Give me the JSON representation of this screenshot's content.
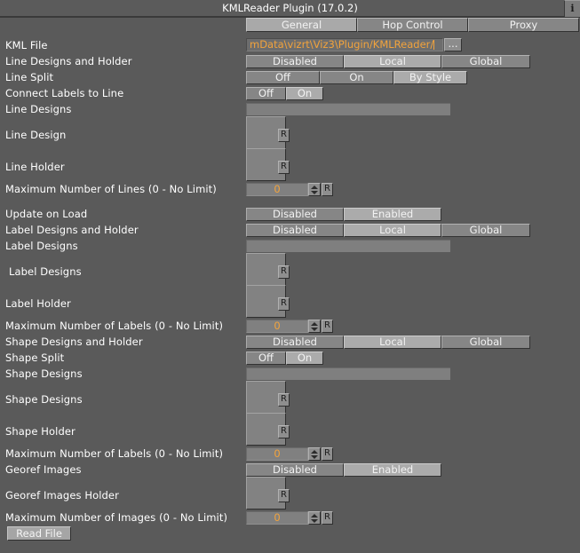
{
  "window": {
    "title": "KMLReader Plugin (17.0.2)",
    "info_button": "i"
  },
  "tabs": [
    {
      "label": "General",
      "selected": true
    },
    {
      "label": "Hop Control",
      "selected": false
    },
    {
      "label": "Proxy",
      "selected": false
    }
  ],
  "fields": {
    "kml_file": {
      "label": "KML File",
      "value": "mData\\vizrt\\Viz3\\Plugin/KMLReader/",
      "browse_label": "..."
    },
    "line_designs_and_holder": {
      "label": "Line Designs and Holder",
      "options": [
        "Disabled",
        "Local",
        "Global"
      ],
      "selected": "Local"
    },
    "line_split": {
      "label": "Line Split",
      "options": [
        "Off",
        "On",
        "By Style"
      ],
      "selected": "By Style"
    },
    "connect_labels_to_line": {
      "label": "Connect Labels to Line",
      "options": [
        "Off",
        "On"
      ],
      "selected": "On"
    },
    "line_designs_bar": {
      "label": "Line Designs"
    },
    "line_design": {
      "label": "Line Design",
      "reset_label": "R"
    },
    "line_holder": {
      "label": "Line Holder",
      "reset_label": "R"
    },
    "max_lines": {
      "label": "Maximum Number of Lines (0 - No Limit)",
      "value": "0",
      "reset_label": "R"
    },
    "update_on_load": {
      "label": "Update on Load",
      "options": [
        "Disabled",
        "Enabled"
      ],
      "selected": "Enabled"
    },
    "label_designs_and_holder": {
      "label": "Label Designs and Holder",
      "options": [
        "Disabled",
        "Local",
        "Global"
      ],
      "selected": "Local"
    },
    "label_designs_bar": {
      "label": "Label Designs"
    },
    "label_designs": {
      "label": "Label Designs",
      "reset_label": "R"
    },
    "label_holder": {
      "label": "Label Holder",
      "reset_label": "R"
    },
    "max_labels": {
      "label": "Maximum Number of Labels (0 - No Limit)",
      "value": "0",
      "reset_label": "R"
    },
    "shape_designs_and_holder": {
      "label": "Shape Designs and Holder",
      "options": [
        "Disabled",
        "Local",
        "Global"
      ],
      "selected": "Local"
    },
    "shape_split": {
      "label": "Shape Split",
      "options": [
        "Off",
        "On"
      ],
      "selected": "On"
    },
    "shape_designs_bar": {
      "label": "Shape Designs"
    },
    "shape_designs": {
      "label": "Shape Designs",
      "reset_label": "R"
    },
    "shape_holder": {
      "label": "Shape Holder",
      "reset_label": "R"
    },
    "max_shape_labels": {
      "label": "Maximum Number of Labels (0 - No Limit)",
      "value": "0",
      "reset_label": "R"
    },
    "georef_images": {
      "label": "Georef Images",
      "options": [
        "Disabled",
        "Enabled"
      ],
      "selected": "Enabled"
    },
    "georef_images_holder": {
      "label": "Georef Images Holder",
      "reset_label": "R"
    },
    "max_images": {
      "label": "Maximum Number of Images (0 - No Limit)",
      "value": "0",
      "reset_label": "R"
    }
  },
  "actions": {
    "read_file": "Read File"
  },
  "colors": {
    "background": "#5a5a5a",
    "accent_text": "#f2a33c",
    "button_face": "#868686",
    "button_selected": "#ababab"
  }
}
